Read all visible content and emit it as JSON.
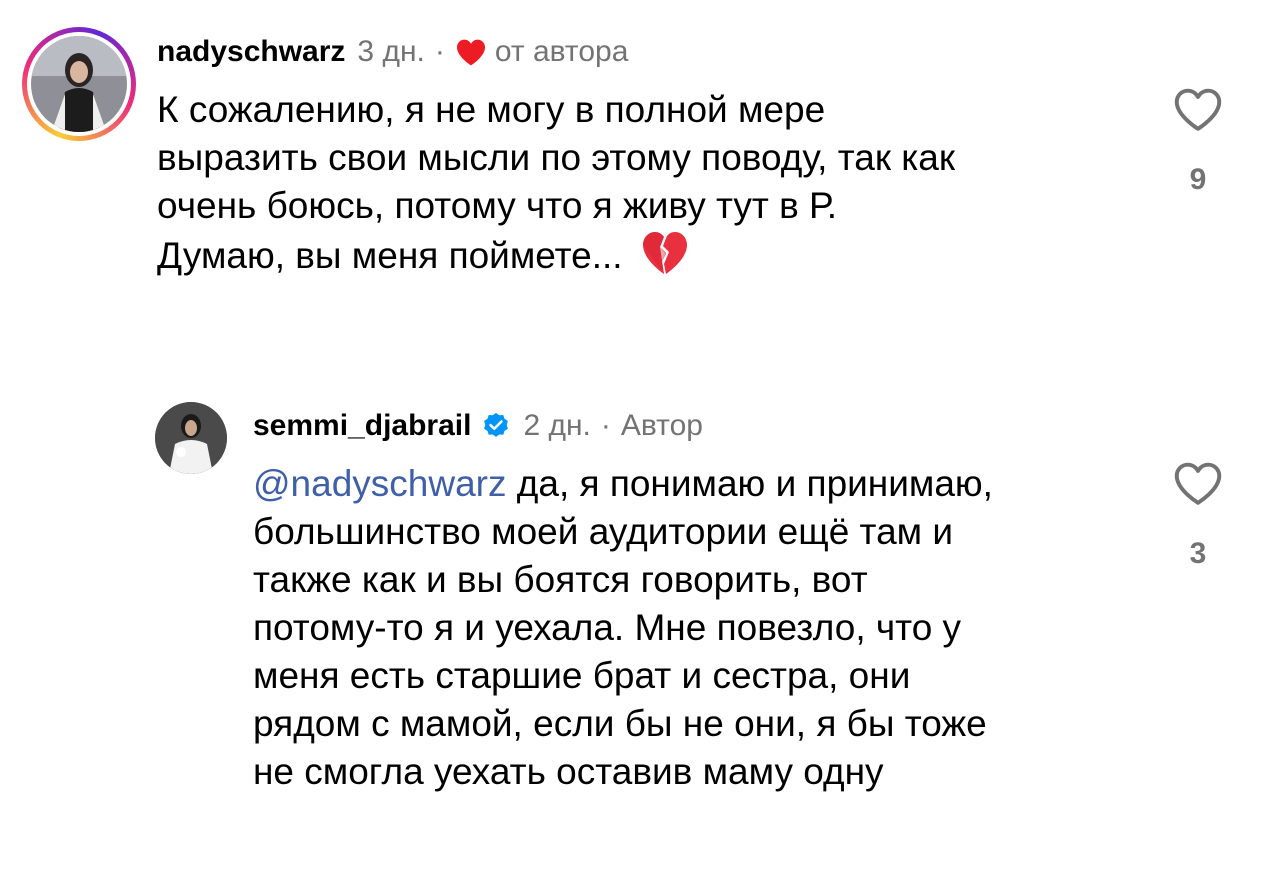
{
  "comments": [
    {
      "username": "nadyschwarz",
      "time": "3 дн.",
      "separator": "·",
      "liked_by_author_label": "от автора",
      "text": "К сожалению, я не могу в полной мере выразить свои мысли по этому поводу, так как очень боюсь, потому что я живу тут в Р. Думаю, вы меня поймете...",
      "lines": [
        "К сожалению, я не могу в полной мере",
        "выразить свои мысли по этому поводу, так как",
        "очень боюсь, потому что я живу тут в Р.",
        "Думаю, вы меня поймете..."
      ],
      "trailing_emoji": "broken-heart",
      "like_count": "9",
      "avatar_has_story_ring": true
    },
    {
      "username": "semmi_djabrail",
      "verified": true,
      "time": "2 дн.",
      "separator": "·",
      "author_label": "Автор",
      "mention": "@nadyschwarz",
      "lines": [
        " да, я понимаю и принимаю,",
        "большинство моей аудитории ещё там и",
        "также как и вы боятся говорить, вот",
        "потому-то я и уехала. Мне повезло, что у",
        "меня есть старшие брат и сестра, они",
        "рядом с мамой, если бы не они, я бы тоже",
        "не смогла уехать оставив маму одну"
      ],
      "like_count": "3"
    }
  ],
  "colors": {
    "text": "#000000",
    "secondary": "#737373",
    "mention": "#3f5fa8",
    "liked_heart": "#ed1c24",
    "verified": "#0095f6"
  },
  "icons": {
    "like": "heart-outline-icon",
    "liked_by_author": "heart-filled-icon",
    "verified": "verified-badge-icon",
    "emoji": "broken-heart-emoji"
  }
}
